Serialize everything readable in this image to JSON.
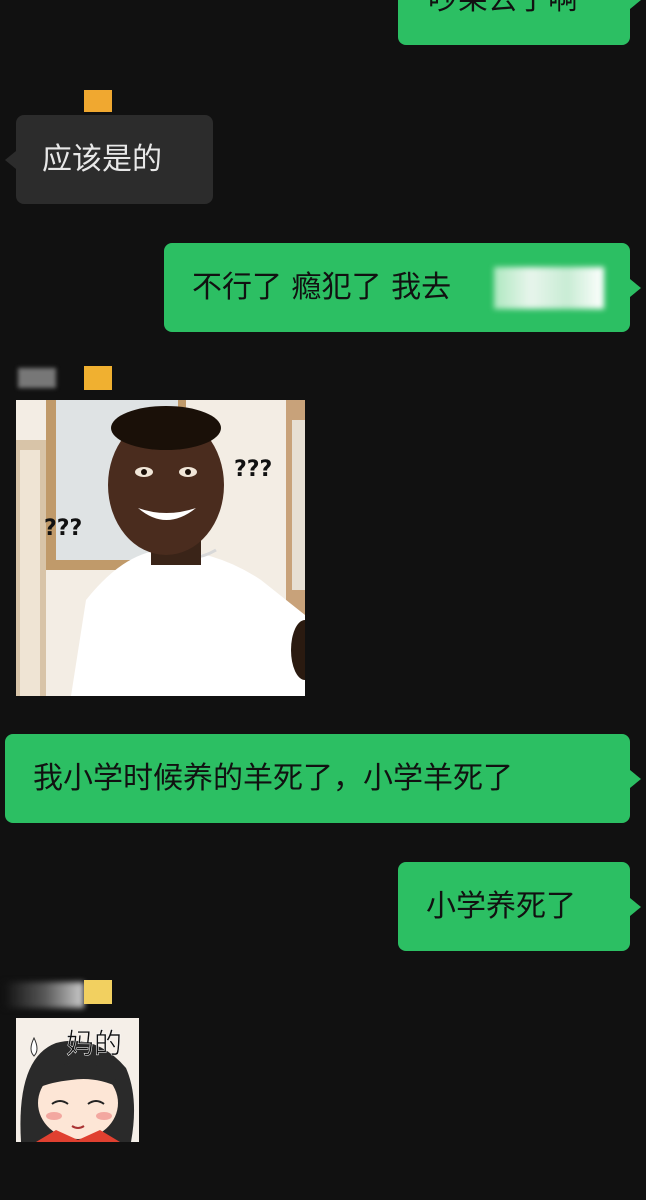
{
  "messages": [
    {
      "id": "m1",
      "side": "out",
      "text": "吵架去了啊"
    },
    {
      "id": "m2",
      "side": "in",
      "text": "应该是的"
    },
    {
      "id": "m3",
      "side": "out",
      "text": "不行了 瘾犯了 我去"
    },
    {
      "id": "m4",
      "side": "in",
      "sticker": "confused-man-meme",
      "sticker_text": "???"
    },
    {
      "id": "m5",
      "side": "out",
      "text": "我小学时候养的羊死了，小学羊死了"
    },
    {
      "id": "m6",
      "side": "out",
      "text": "小学养死了"
    },
    {
      "id": "m7",
      "side": "in",
      "sticker": "cartoon-girl-sticker",
      "sticker_text": "妈的"
    }
  ],
  "colors": {
    "background": "#111111",
    "outgoing_bubble": "#2cbf63",
    "incoming_bubble": "#2c2c2c",
    "name_tag": "#f0b030"
  }
}
